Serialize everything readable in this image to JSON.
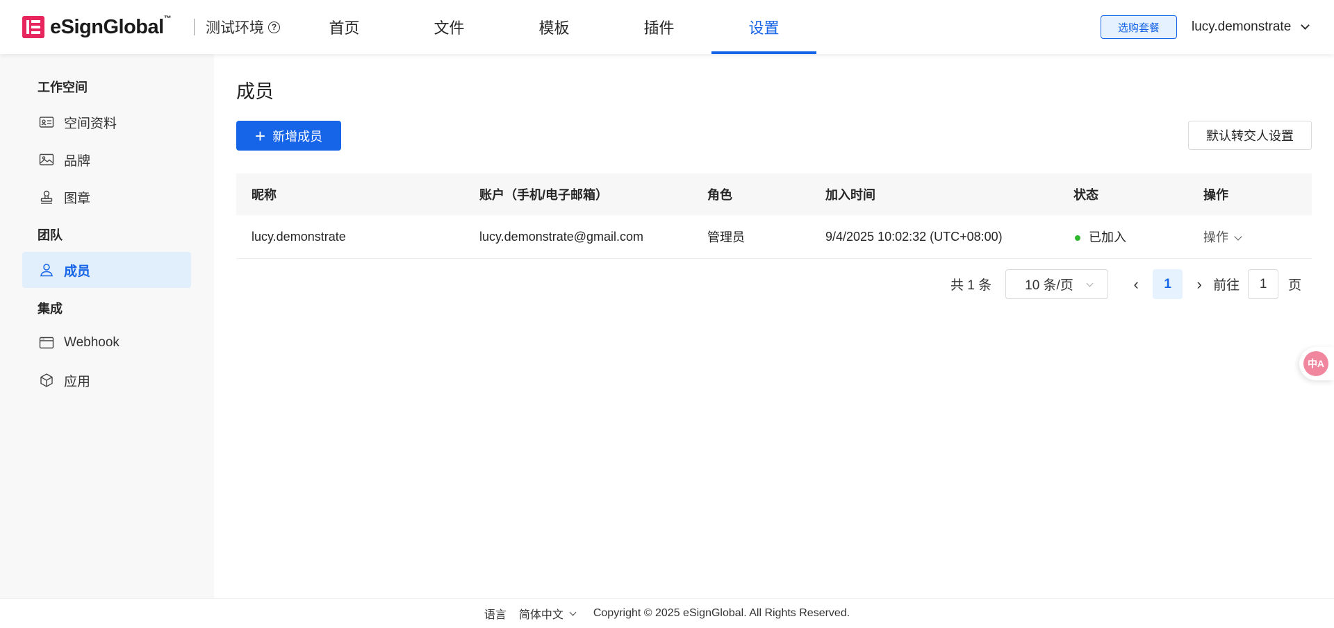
{
  "header": {
    "logo_text": "eSignGlobal",
    "logo_tm": "™",
    "env_label": "测试环境",
    "help_glyph": "?",
    "nav": [
      {
        "label": "首页",
        "active": false
      },
      {
        "label": "文件",
        "active": false
      },
      {
        "label": "模板",
        "active": false
      },
      {
        "label": "插件",
        "active": false
      },
      {
        "label": "设置",
        "active": true
      }
    ],
    "plan_button": "选购套餐",
    "username": "lucy.demonstrate"
  },
  "sidebar": {
    "groups": [
      {
        "title": "工作空间",
        "items": [
          {
            "label": "空间资料",
            "icon": "id-card-icon"
          },
          {
            "label": "品牌",
            "icon": "image-icon"
          },
          {
            "label": "图章",
            "icon": "stamp-icon"
          }
        ]
      },
      {
        "title": "团队",
        "items": [
          {
            "label": "成员",
            "icon": "user-icon",
            "active": true
          }
        ]
      },
      {
        "title": "集成",
        "items": [
          {
            "label": "Webhook",
            "icon": "browser-window-icon"
          },
          {
            "label": "应用",
            "icon": "cube-icon"
          }
        ]
      }
    ]
  },
  "main": {
    "title": "成员",
    "add_button": "新增成员",
    "add_glyph": "+",
    "transfer_button": "默认转交人设置",
    "table": {
      "columns": [
        "昵称",
        "账户（手机/电子邮箱）",
        "角色",
        "加入时间",
        "状态",
        "操作"
      ],
      "rows": [
        {
          "nickname": "lucy.demonstrate",
          "account": "lucy.demonstrate@gmail.com",
          "role": "管理员",
          "joined": "9/4/2025 10:02:32 (UTC+08:00)",
          "status": "已加入",
          "action": "操作"
        }
      ]
    },
    "pagination": {
      "total": "共 1 条",
      "page_size": "10 条/页",
      "prev_glyph": "‹",
      "next_glyph": "›",
      "current_page": "1",
      "goto_label": "前往",
      "goto_value": "1",
      "page_suffix": "页"
    }
  },
  "float_widget": {
    "glyph": "中A"
  },
  "footer": {
    "language_label": "语言",
    "language_value": "简体中文",
    "copyright": "Copyright © 2025 eSignGlobal. All Rights Reserved."
  },
  "colors": {
    "primary": "#1664e8",
    "brand": "#e8265e",
    "status_joined": "#2eb82e",
    "sidebar_active_bg": "#e1effc"
  }
}
